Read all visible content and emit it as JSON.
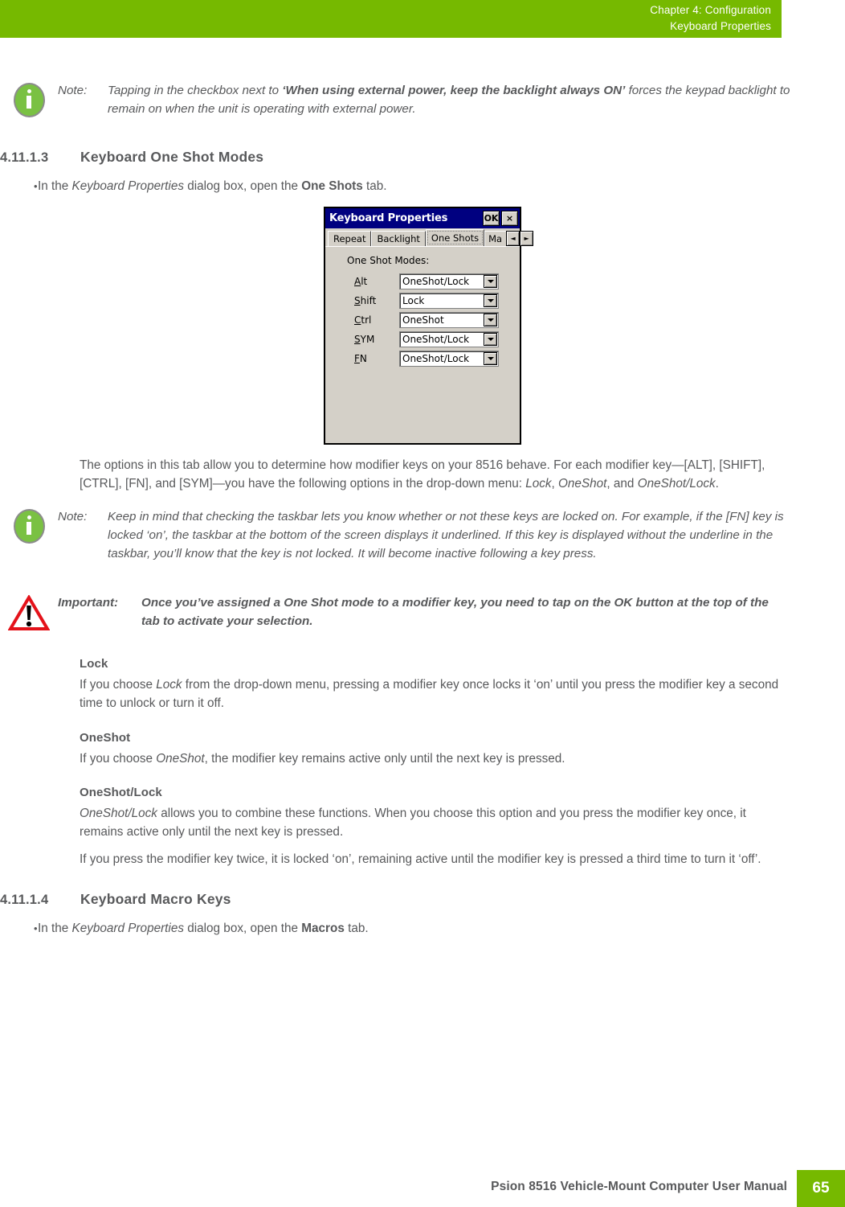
{
  "header": {
    "chapter": "Chapter 4:  Configuration",
    "section": "Keyboard Properties",
    "accent_color": "#76b900"
  },
  "note_top": {
    "icon": "info-icon",
    "label": "Note:",
    "text_part1": "Tapping in the checkbox next to ",
    "text_bold": "‘When using external power, keep the backlight always ON’",
    "text_part2": " forces the keypad backlight to remain on when the unit is operating with external power."
  },
  "section_one_shot": {
    "number": "4.11.1.3",
    "title": "Keyboard One Shot Modes",
    "bullet": {
      "dot": "•",
      "pre": "In the ",
      "italic": "Keyboard Properties",
      "mid": " dialog box, open the ",
      "bold": "One Shots",
      "post": " tab."
    }
  },
  "dialog": {
    "title": "Keyboard Properties",
    "ok_label": "OK",
    "close_label": "×",
    "tabs": [
      {
        "label": "Repeat",
        "active": false
      },
      {
        "label": "Backlight",
        "active": false
      },
      {
        "label": "One Shots",
        "active": true
      },
      {
        "label": "Ma",
        "active": false
      }
    ],
    "scroll_left": "◄",
    "scroll_right": "►",
    "group_label": "One Shot Modes:",
    "rows": [
      {
        "key_accel": "A",
        "key_rest": "lt",
        "value": "OneShot/Lock"
      },
      {
        "key_accel": "S",
        "key_rest": "hift",
        "value": "Lock"
      },
      {
        "key_accel": "C",
        "key_rest": "trl",
        "value": "OneShot"
      },
      {
        "key_accel": "S",
        "key_rest": "YM",
        "value": "OneShot/Lock"
      },
      {
        "key_accel": "F",
        "key_rest": "N",
        "value": "OneShot/Lock"
      }
    ],
    "options": [
      "Lock",
      "OneShot",
      "OneShot/Lock"
    ]
  },
  "paragraph_options": {
    "line1": "The options in this tab allow you to determine how modifier keys on your 8516 behave. For each modifier key—[ALT], [SHIFT], [CTRL], [FN], and [SYM]—you have the following options in the drop-down menu: ",
    "italic1": "Lock",
    "sep1": ", ",
    "italic2": "OneShot",
    "sep2": ", and ",
    "italic3": "OneShot/Lock",
    "end": "."
  },
  "note_taskbar": {
    "icon": "info-icon",
    "label": "Note:",
    "text": "Keep in mind that checking the taskbar lets you know whether or not these keys are locked on. For example, if the [FN] key is locked ‘on’, the taskbar at the bottom of the screen displays it underlined. If this key is displayed without the underline in the taskbar, you’ll know that the key is not locked. It will become inactive following a key press."
  },
  "important": {
    "icon": "warning-triangle-icon",
    "label": "Important:",
    "text": "Once you’ve assigned a One Shot mode to a modifier key, you need to tap on the OK button at the top of the tab to activate your selection."
  },
  "subsections": [
    {
      "heading": "Lock",
      "paragraphs": [
        {
          "pre": "If you choose ",
          "italic": "Lock",
          "post": " from the drop-down menu, pressing a modifier key once locks it ‘on’ until you press the modifier key a second time to unlock or turn it off."
        }
      ]
    },
    {
      "heading": "OneShot",
      "paragraphs": [
        {
          "pre": "If you choose ",
          "italic": "OneShot",
          "post": ", the modifier key remains active only until the next key is pressed."
        }
      ]
    },
    {
      "heading": "OneShot/Lock",
      "paragraphs": [
        {
          "pre": "",
          "italic": "OneShot/Lock",
          "post": " allows you to combine these functions. When you choose this option and you press the modifier key once, it remains active only until the next key is pressed."
        },
        {
          "pre": "If you press the modifier key twice, it is locked ‘on’, remaining active until the modifier key is pressed a third time to turn it ‘off’.",
          "italic": "",
          "post": ""
        }
      ]
    }
  ],
  "section_macro": {
    "number": "4.11.1.4",
    "title": "Keyboard Macro Keys",
    "bullet": {
      "dot": "•",
      "pre": "In the ",
      "italic": "Keyboard Properties",
      "mid": " dialog box, open the ",
      "bold": "Macros",
      "post": " tab."
    }
  },
  "footer": {
    "title": "Psion 8516 Vehicle-Mount Computer User Manual",
    "page": "65",
    "accent_color": "#76b900"
  }
}
